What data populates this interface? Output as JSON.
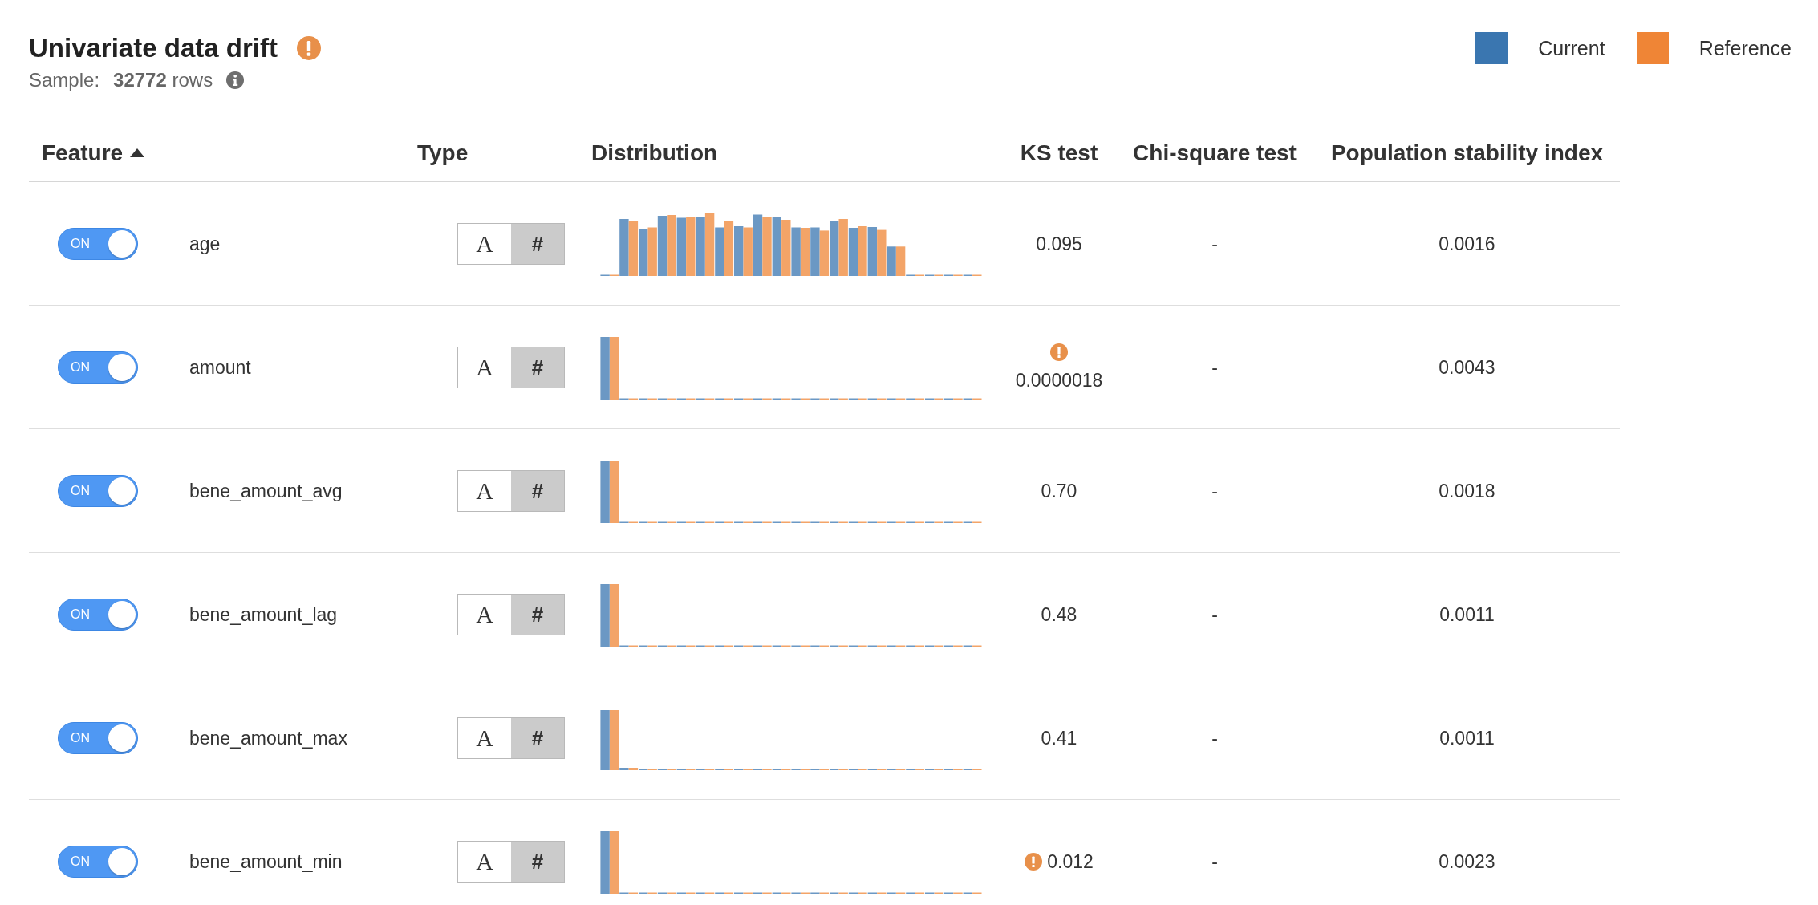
{
  "header": {
    "title": "Univariate data drift",
    "warning": true,
    "sample": {
      "label": "Sample:",
      "value": "**32772** rows"
    }
  },
  "legend": [
    {
      "label": "Current",
      "color": "#3a76b0"
    },
    {
      "label": "Reference",
      "color": "#ef8536"
    }
  ],
  "table": {
    "columns": [
      {
        "label": "Feature",
        "sorted_ascending": true
      },
      {
        "label": "Type"
      },
      {
        "label": "Distribution"
      },
      {
        "label": "KS test"
      },
      {
        "label": "Chi-square test"
      },
      {
        "label": "Population stability index"
      }
    ],
    "rows": [
      {
        "toggle": {
          "on": true,
          "label": "ON"
        },
        "feature": "age",
        "type_options": [
          {
            "kind": "text",
            "label": "A",
            "selected": false
          },
          {
            "kind": "number",
            "label": "#",
            "selected": true
          }
        ],
        "ks_test": "0.095",
        "ks_warning": false,
        "chi_square_test": "-",
        "psi": "0.0016"
      },
      {
        "toggle": {
          "on": true,
          "label": "ON"
        },
        "feature": "amount",
        "type_options": [
          {
            "kind": "text",
            "label": "A",
            "selected": false
          },
          {
            "kind": "number",
            "label": "#",
            "selected": true
          }
        ],
        "ks_test": "0.0000018",
        "ks_warning": true,
        "chi_square_test": "-",
        "psi": "0.0043"
      },
      {
        "toggle": {
          "on": true,
          "label": "ON"
        },
        "feature": "bene_amount_avg",
        "type_options": [
          {
            "kind": "text",
            "label": "A",
            "selected": false
          },
          {
            "kind": "number",
            "label": "#",
            "selected": true
          }
        ],
        "ks_test": "0.70",
        "ks_warning": false,
        "chi_square_test": "-",
        "psi": "0.0018"
      },
      {
        "toggle": {
          "on": true,
          "label": "ON"
        },
        "feature": "bene_amount_lag",
        "type_options": [
          {
            "kind": "text",
            "label": "A",
            "selected": false
          },
          {
            "kind": "number",
            "label": "#",
            "selected": true
          }
        ],
        "ks_test": "0.48",
        "ks_warning": false,
        "chi_square_test": "-",
        "psi": "0.0011"
      },
      {
        "toggle": {
          "on": true,
          "label": "ON"
        },
        "feature": "bene_amount_max",
        "type_options": [
          {
            "kind": "text",
            "label": "A",
            "selected": false
          },
          {
            "kind": "number",
            "label": "#",
            "selected": true
          }
        ],
        "ks_test": "0.41",
        "ks_warning": false,
        "chi_square_test": "-",
        "psi": "0.0011"
      },
      {
        "toggle": {
          "on": true,
          "label": "ON"
        },
        "feature": "bene_amount_min",
        "type_options": [
          {
            "kind": "text",
            "label": "A",
            "selected": false
          },
          {
            "kind": "number",
            "label": "#",
            "selected": true
          }
        ],
        "ks_test": "0.012",
        "ks_warning": true,
        "chi_square_test": "-",
        "psi": "0.0023"
      }
    ]
  }
}
